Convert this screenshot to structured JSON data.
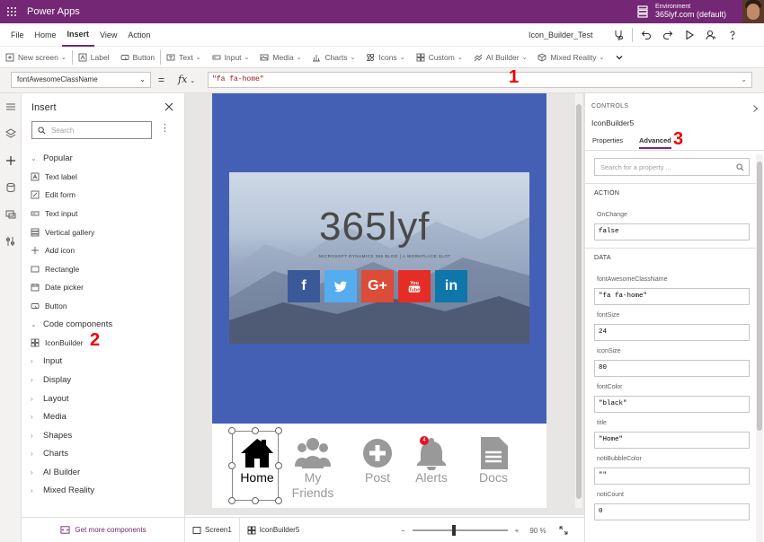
{
  "topbar": {
    "app_name": "Power Apps",
    "environment_label": "Environment",
    "environment_name": "365lyf.com (default)"
  },
  "menu": {
    "items": [
      "File",
      "Home",
      "Insert",
      "View",
      "Action"
    ],
    "active": "Insert",
    "app_title": "Icon_Builder_Test"
  },
  "ribbon": {
    "items": [
      {
        "label": "New screen",
        "icon": "new-screen-icon",
        "dropdown": true
      },
      {
        "label": "Label",
        "icon": "label-icon",
        "dropdown": false
      },
      {
        "label": "Button",
        "icon": "button-icon",
        "dropdown": false
      },
      {
        "label": "Text",
        "icon": "text-icon",
        "dropdown": true
      },
      {
        "label": "Input",
        "icon": "input-icon",
        "dropdown": true
      },
      {
        "label": "Media",
        "icon": "media-icon",
        "dropdown": true
      },
      {
        "label": "Charts",
        "icon": "charts-icon",
        "dropdown": true
      },
      {
        "label": "Icons",
        "icon": "icons-icon",
        "dropdown": true
      },
      {
        "label": "Custom",
        "icon": "custom-icon",
        "dropdown": true
      },
      {
        "label": "AI Builder",
        "icon": "ai-builder-icon",
        "dropdown": true
      },
      {
        "label": "Mixed Reality",
        "icon": "mixed-reality-icon",
        "dropdown": true
      }
    ]
  },
  "formula": {
    "property": "fontAwesomeClassName",
    "equals": "=",
    "fx": "fx",
    "value": "\"fa fa-home\""
  },
  "annotations": {
    "one": "1",
    "two": "2",
    "three": "3"
  },
  "insert_panel": {
    "title": "Insert",
    "search_placeholder": "Search",
    "footer": "Get more components",
    "list": [
      {
        "type": "cat",
        "label": "Popular",
        "open": true
      },
      {
        "type": "item",
        "label": "Text label",
        "icon": "text-label-icon"
      },
      {
        "type": "item",
        "label": "Edit form",
        "icon": "edit-form-icon"
      },
      {
        "type": "item",
        "label": "Text input",
        "icon": "text-input-icon"
      },
      {
        "type": "item",
        "label": "Vertical gallery",
        "icon": "gallery-icon"
      },
      {
        "type": "item",
        "label": "Add icon",
        "icon": "plus-icon"
      },
      {
        "type": "item",
        "label": "Rectangle",
        "icon": "rectangle-icon"
      },
      {
        "type": "item",
        "label": "Date picker",
        "icon": "calendar-icon"
      },
      {
        "type": "item",
        "label": "Button",
        "icon": "button-icon"
      },
      {
        "type": "cat",
        "label": "Code components",
        "open": true
      },
      {
        "type": "item",
        "label": "IconBuilder",
        "icon": "code-component-icon"
      },
      {
        "type": "cat",
        "label": "Input",
        "open": false
      },
      {
        "type": "cat",
        "label": "Display",
        "open": false
      },
      {
        "type": "cat",
        "label": "Layout",
        "open": false
      },
      {
        "type": "cat",
        "label": "Media",
        "open": false
      },
      {
        "type": "cat",
        "label": "Shapes",
        "open": false
      },
      {
        "type": "cat",
        "label": "Charts",
        "open": false
      },
      {
        "type": "cat",
        "label": "AI Builder",
        "open": false
      },
      {
        "type": "cat",
        "label": "Mixed Reality",
        "open": false
      }
    ]
  },
  "canvas": {
    "brand": "365lyf",
    "brand_sub": "MICROSOFT DYNAMICS 365 BLOG | A WORKPLACE SLOT",
    "socials": [
      {
        "name": "facebook",
        "glyph": "f",
        "color": "#3b5998"
      },
      {
        "name": "twitter",
        "glyph": "",
        "color": "#55acee"
      },
      {
        "name": "google-plus",
        "glyph": "G+",
        "color": "#dd4b39"
      },
      {
        "name": "youtube",
        "glyph": "",
        "color": "#e52d27"
      },
      {
        "name": "linkedin",
        "glyph": "in",
        "color": "#0e76a8"
      }
    ],
    "nav": [
      {
        "label": "Home",
        "icon": "home-icon",
        "selected": true
      },
      {
        "label": "My Friends",
        "icon": "users-icon",
        "selected": false
      },
      {
        "label": "Post",
        "icon": "plus-circle-icon",
        "selected": false
      },
      {
        "label": "Alerts",
        "icon": "bell-icon",
        "selected": false,
        "badge": "4"
      },
      {
        "label": "Docs",
        "icon": "document-icon",
        "selected": false
      }
    ]
  },
  "statusbar": {
    "screen": "Screen1",
    "component": "IconBuilder5",
    "zoom_minus": "−",
    "zoom_plus": "+",
    "zoom_value": "90 %",
    "zoom_fraction": 0.44
  },
  "right_panel": {
    "category": "CONTROLS",
    "control_name": "IconBuilder5",
    "tabs": [
      "Properties",
      "Advanced"
    ],
    "active_tab": "Advanced",
    "search_placeholder": "Search for a property ...",
    "sections": [
      {
        "title": "ACTION",
        "props": [
          {
            "name": "OnChange",
            "value": "false"
          }
        ]
      },
      {
        "title": "DATA",
        "props": [
          {
            "name": "fontAwesomeClassName",
            "value": "\"fa fa-home\""
          },
          {
            "name": "fontSize",
            "value": "24"
          },
          {
            "name": "iconSize",
            "value": "80"
          },
          {
            "name": "fontColor",
            "value": "\"black\""
          },
          {
            "name": "title",
            "value": "\"Home\""
          },
          {
            "name": "notiBubbleColor",
            "value": "\"\""
          },
          {
            "name": "notiCount",
            "value": "0"
          }
        ]
      }
    ]
  },
  "colors": {
    "brand_purple": "#742774",
    "canvas_blue": "#4460b5",
    "annotation_red": "#e00000"
  }
}
